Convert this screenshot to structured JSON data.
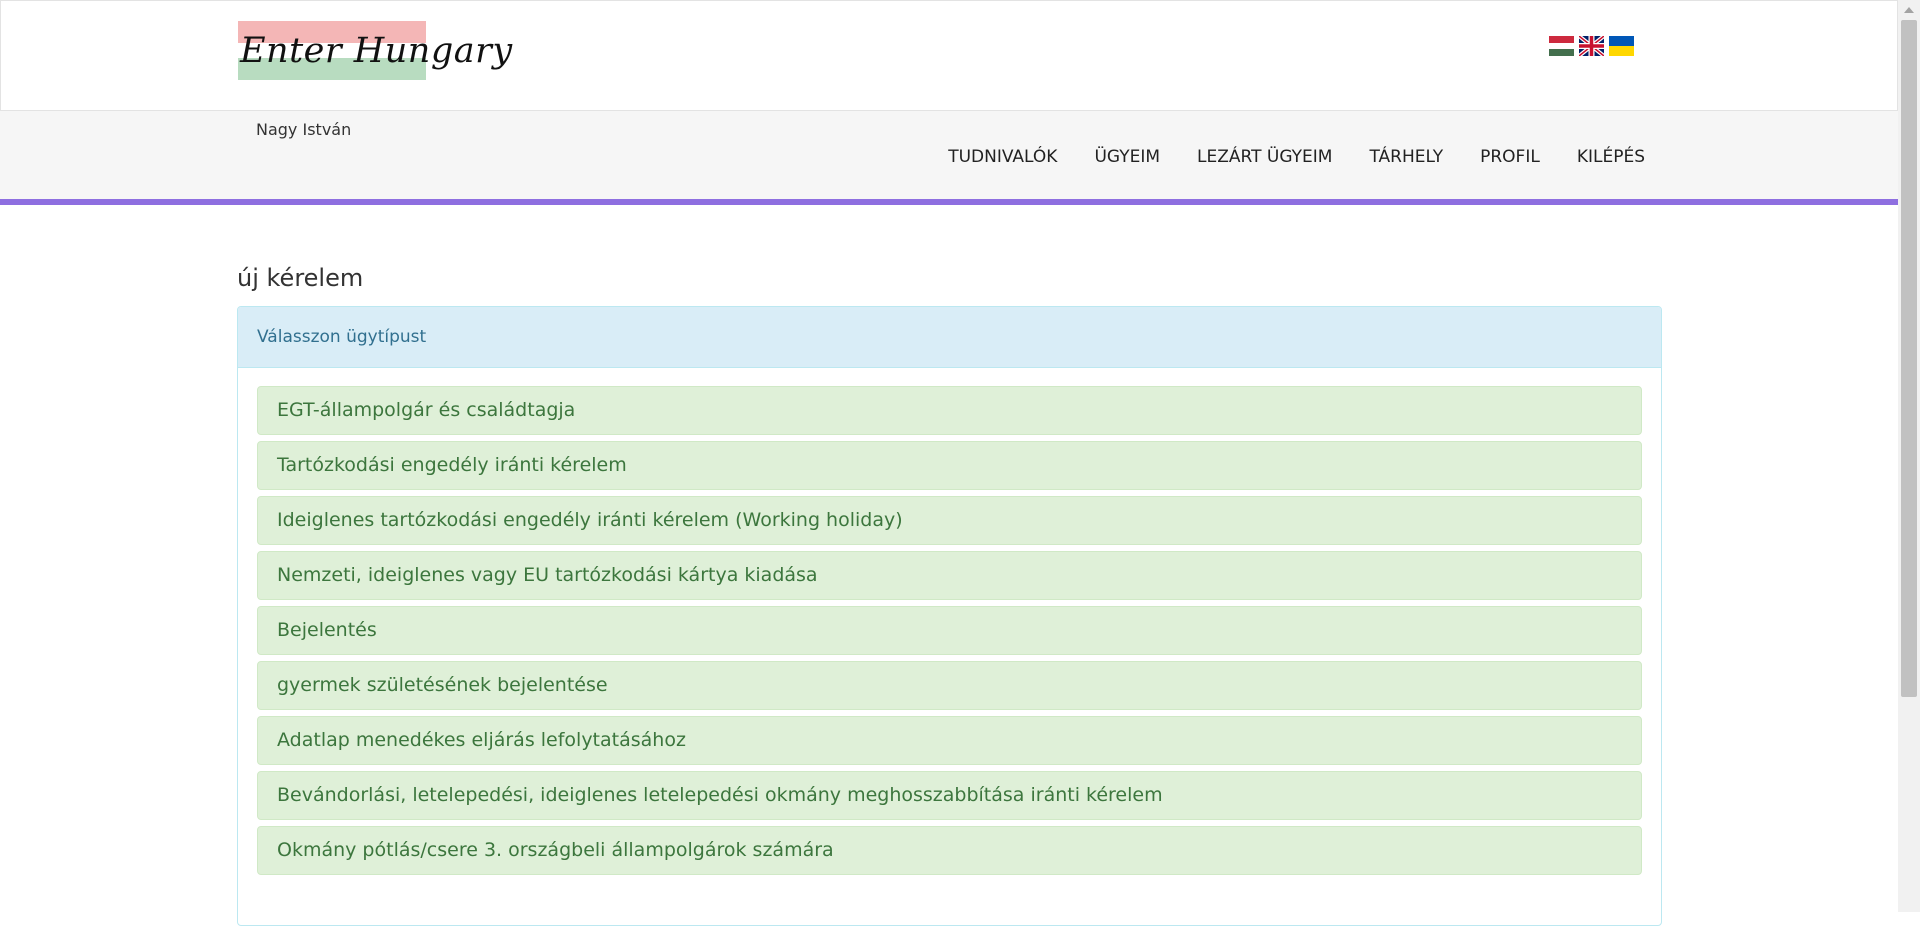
{
  "header": {
    "logo_text": "Enter Hungary",
    "languages": [
      {
        "code": "hu",
        "icon": "hungarian-flag-icon"
      },
      {
        "code": "en",
        "icon": "uk-flag-icon"
      },
      {
        "code": "ua",
        "icon": "ukrainian-flag-icon"
      }
    ]
  },
  "nav": {
    "user_name": "Nagy István",
    "links": [
      "TUDNIVALÓK",
      "ÜGYEIM",
      "LEZÁRT ÜGYEIM",
      "TÁRHELY",
      "PROFIL",
      "KILÉPÉS"
    ],
    "accent_color": "#8e6fe0"
  },
  "main": {
    "heading": "új kérelem",
    "panel_title": "Válasszon ügytípust",
    "case_types": [
      "EGT-állampolgár és családtagja",
      "Tartózkodási engedély iránti kérelem",
      "Ideiglenes tartózkodási engedély iránti kérelem (Working holiday)",
      "Nemzeti, ideiglenes vagy EU tartózkodási kártya kiadása",
      "Bejelentés",
      "gyermek születésének bejelentése",
      "Adatlap menedékes eljárás lefolytatásához",
      "Bevándorlási, letelepedési, ideiglenes letelepedési okmány meghosszabbítása iránti kérelem",
      "Okmány pótlás/csere 3. országbeli állampolgárok számára"
    ]
  }
}
